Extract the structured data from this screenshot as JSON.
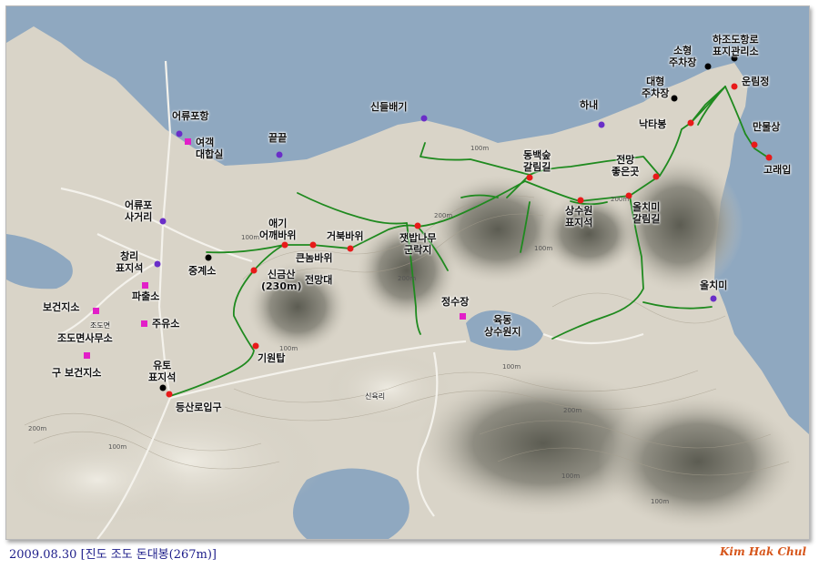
{
  "caption": "2009.08.30 [진도 조도 돈대봉(267m)]",
  "signature": "Kim Hak Chul",
  "colors": {
    "sea": "#8fa8c0",
    "land": "#dcd7cc",
    "route": "#1f8a1f",
    "poi_red": "#e81a1a",
    "poi_purple": "#6a2ec8",
    "poi_pink": "#e21fc8",
    "poi_black": "#000000"
  },
  "labels": {
    "hajodo": "하조도항로\n표지관리소",
    "small_parking": "소형\n주차장",
    "unrimjeong": "운림정",
    "large_parking": "대형\n주차장",
    "hanae": "하내",
    "natabong": "낙타봉",
    "manmulsang": "만물상",
    "goraeip": "고래입",
    "sindeulbaegi": "신들배기",
    "kkeutkeut": "끝끝",
    "eoryupohang": "어류포항",
    "yeogaek": "여객\n대합실",
    "dongbaek": "동백숲\n갈림길",
    "jeonmang_good": "전망\n좋은곳",
    "sangsuwon": "상수원\n표지석",
    "olchimi_junction": "올치미\n갈림길",
    "eoryupo_crossroad": "어류포\n사거리",
    "aegi": "애기\n어깨바위",
    "keunnom": "큰놈바위",
    "geobuk": "거북바위",
    "jaetbap": "잿밥나무\n군락지",
    "changri": "창리\n표지석",
    "junggyeso": "중계소",
    "singeumsan": "신금산\n(230m)",
    "jeonmangdae": "전망대",
    "olchimi": "올치미",
    "bogeonjiso": "보건지소",
    "pachulso": "파출소",
    "jeongsujang": "정수장",
    "jodomyeon_small": "조도면",
    "juyuso": "주유소",
    "yukdong": "육동\n상수원지",
    "jodomyeon_office": "조도면사무소",
    "old_bogeon": "구 보건지소",
    "yuto": "유토\n표지석",
    "giwontap": "기원탑",
    "trailhead": "등산로입구",
    "sinyukri": "신육리"
  },
  "contours": [
    "100m",
    "100m",
    "200m",
    "200m",
    "100m",
    "200m",
    "100m",
    "200m",
    "100m",
    "100m",
    "200m",
    "100m",
    "100m"
  ],
  "icons": {
    "red": "red-dot-icon",
    "purple": "purple-dot-icon",
    "pink": "pink-square-icon",
    "black": "black-dot-icon"
  }
}
